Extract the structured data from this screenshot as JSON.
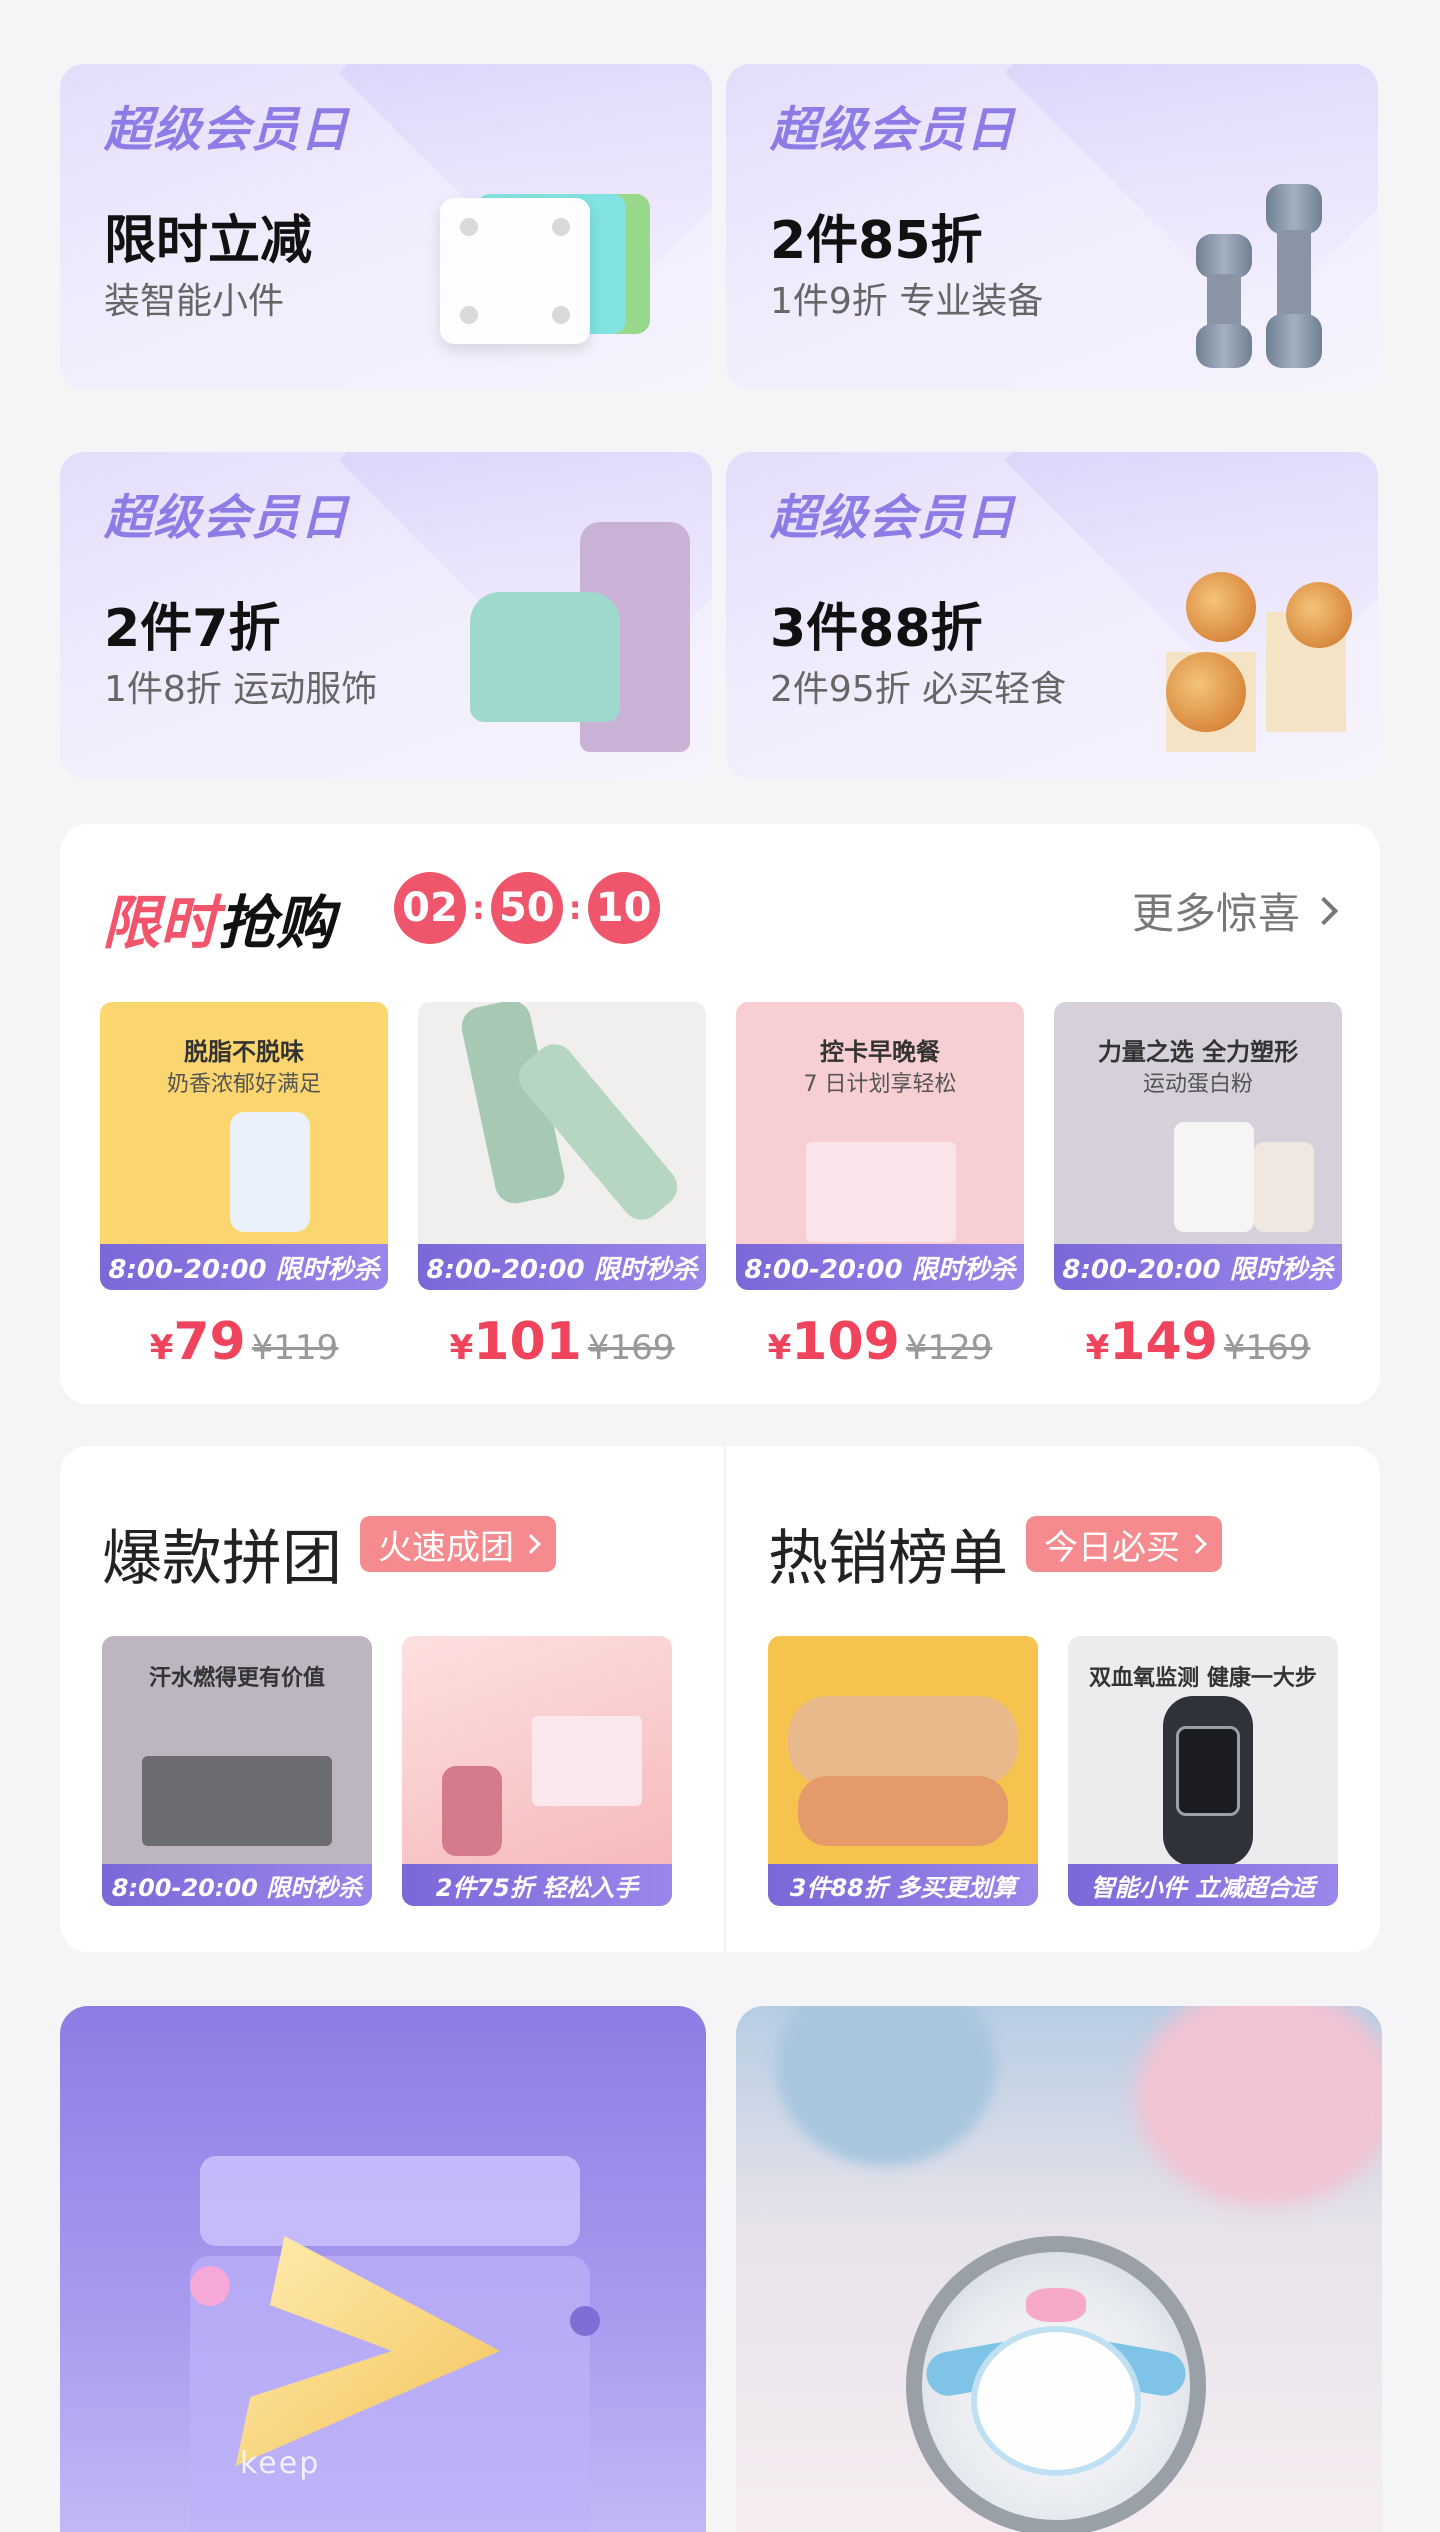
{
  "promos": [
    {
      "tag": "超级会员日",
      "title": "限时立减",
      "subtitle": "装智能小件",
      "image": "smart-scale"
    },
    {
      "tag": "超级会员日",
      "title": "2件85折",
      "subtitle": "1件9折  专业装备",
      "image": "dumbbells"
    },
    {
      "tag": "超级会员日",
      "title": "2件7折",
      "subtitle": "1件8折  运动服饰",
      "image": "sportswear"
    },
    {
      "tag": "超级会员日",
      "title": "3件88折",
      "subtitle": "2件95折  必买轻食",
      "image": "snacks"
    }
  ],
  "flash_sale": {
    "title_highlight": "限时",
    "title_rest": "抢购",
    "timer": {
      "hours": "02",
      "minutes": "50",
      "seconds": "10"
    },
    "more_label": "更多惊喜",
    "items": [
      {
        "caption": "脱脂不脱味",
        "caption2": "奶香浓郁好满足",
        "ribbon": "8:00-20:00 限时秒杀",
        "currency": "¥",
        "price": "79",
        "original": "¥119",
        "bg": "#fbd56e"
      },
      {
        "caption": "",
        "caption2": "",
        "ribbon": "8:00-20:00 限时秒杀",
        "currency": "¥",
        "price": "101",
        "original": "¥169",
        "bg": "#f1efee"
      },
      {
        "caption": "控卡早晚餐",
        "caption2": "7 日计划享轻松",
        "ribbon": "8:00-20:00 限时秒杀",
        "currency": "¥",
        "price": "109",
        "original": "¥129",
        "bg": "#f7cfd3"
      },
      {
        "caption": "力量之选 全力塑形",
        "caption2": "运动蛋白粉",
        "ribbon": "8:00-20:00 限时秒杀",
        "currency": "¥",
        "price": "149",
        "original": "¥169",
        "bg": "#d5d0da"
      }
    ]
  },
  "group_buy": {
    "title": "爆款拼团",
    "pill": "火速成团",
    "items": [
      {
        "top": "汗水燃得更有价值",
        "ribbon": "8:00-20:00 限时秒杀",
        "bg": "#bdb6c0"
      },
      {
        "top": "",
        "ribbon": "2件75折  轻松入手",
        "bg": "#f7c7c6"
      }
    ]
  },
  "hot_list": {
    "title": "热销榜单",
    "pill": "今日必买",
    "items": [
      {
        "top": "",
        "ribbon": "3件88折  多买更划算",
        "bg": "#f6c34e"
      },
      {
        "top": "双血氧监测 健康一大步",
        "ribbon": "智能小件 立减超合适",
        "bg": "#ececee"
      }
    ]
  },
  "banners": {
    "left_logo_text": "keep"
  },
  "colors": {
    "accent": "#f0566b",
    "member_purple": "#8e7ce6",
    "ribbon": "#7b68d8",
    "pill": "#f58a8f"
  }
}
